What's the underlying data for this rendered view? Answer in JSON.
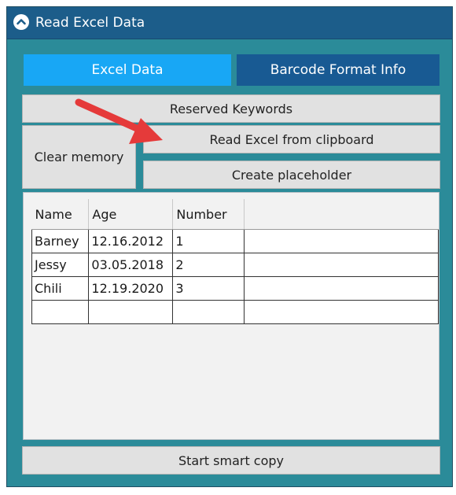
{
  "window": {
    "title": "Read Excel Data",
    "collapse_icon": "chevron-up-icon"
  },
  "tabs": [
    {
      "label": "Excel Data",
      "active": true
    },
    {
      "label": "Barcode Format Info",
      "active": false
    }
  ],
  "buttons": {
    "reserved_keywords": "Reserved Keywords",
    "clear_memory": "Clear memory",
    "read_excel": "Read Excel from clipboard",
    "create_placeholder": "Create placeholder",
    "start_smart_copy": "Start smart copy"
  },
  "table": {
    "columns": [
      "Name",
      "Age",
      "Number",
      ""
    ],
    "rows": [
      [
        "Barney",
        "12.16.2012",
        "1",
        ""
      ],
      [
        "Jessy",
        "03.05.2018",
        "2",
        ""
      ],
      [
        "Chili",
        "12.19.2020",
        "3",
        ""
      ],
      [
        "",
        "",
        "",
        ""
      ]
    ]
  },
  "colors": {
    "panel": "#2b8b99",
    "titlebar": "#1c5d8a",
    "tab_active": "#18a7f5",
    "tab_inactive": "#185a93",
    "button": "#e1e1e1",
    "annotation_arrow": "#e53a3a"
  },
  "annotation": {
    "icon": "red-arrow-icon"
  }
}
